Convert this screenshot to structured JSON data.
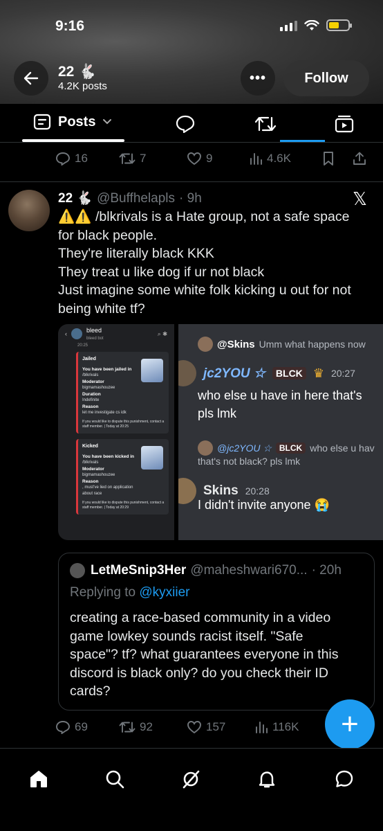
{
  "status_bar": {
    "time": "9:16"
  },
  "header": {
    "name": "22 🐇",
    "post_count": "4.2K posts",
    "more_label": "•••",
    "follow_label": "Follow"
  },
  "tabs": {
    "posts_label": "Posts"
  },
  "prev_actions": {
    "replies": "16",
    "reposts": "7",
    "likes": "9",
    "views": "4.6K"
  },
  "tweet": {
    "name": "22 🐇",
    "handle": "@Buffhelapls",
    "time": "· 9h",
    "lines": [
      "⚠️⚠️ /blkrivals is a Hate group, not a safe space",
      "for black people.",
      "They're literally black KKK",
      "They treat u like dog if ur not black",
      "Just imagine some white folk kicking u out for not",
      "being white tf?"
    ]
  },
  "media_left": {
    "bot_name": "bleed",
    "bot_sub": "bleed bot",
    "time": "20:25",
    "jailed": {
      "title": "Jailed",
      "l1": "You have been jailed in",
      "l2": "/blkrivals",
      "mod_label": "Moderator",
      "mod": "bigmamashouzee",
      "dur_label": "Duration",
      "dur": "Indefinite",
      "reason_label": "Reason",
      "reason": "let me investigate cs idk",
      "footer": "If you would like to dispute this punishment, contact a staff member. | Today at 20:25"
    },
    "kicked": {
      "title": "Kicked",
      "l1": "You have been kicked in",
      "l2": "/blkrivals",
      "mod_label": "Moderator",
      "mod": "bigmamashouzee",
      "reason_label": "Reason",
      "reason": ", must've lied on application about race",
      "footer": "If you would like to dispute this punishment, contact a staff member. | Today at 20:29"
    }
  },
  "media_right": {
    "reply1_user": "@Skins",
    "reply1_text": "Umm what happens now",
    "msg1_user": "jc2YOU ☆",
    "msg1_badge": "BLCK",
    "msg1_time": "20:27",
    "msg1_line1": "who else u have in here that's",
    "msg1_line2": "pls lmk",
    "reply2_user": "@jc2YOU ☆",
    "reply2_badge": "BLCK",
    "reply2_text": "who else u hav",
    "reply2_line2": "that's not black? pls lmk",
    "msg2_user": "Skins",
    "msg2_time": "20:28",
    "msg2_text": "I didn't invite anyone 😭"
  },
  "quote": {
    "name": "LetMeSnip3Her",
    "handle": "@maheshwari670...",
    "time": "· 20h",
    "replying_prefix": "Replying to",
    "replying_to": "@kyxiier",
    "lines": [
      "creating a race-based community in a video",
      "game lowkey sounds racist itself. \"Safe",
      "space\"? tf? what  guarantees everyone in this",
      "discord is black only? do you check their ID",
      "cards?"
    ]
  },
  "tweet_actions": {
    "replies": "69",
    "reposts": "92",
    "likes": "157",
    "views": "116K"
  },
  "fab_label": "+",
  "colors": {
    "accent": "#1d9bf0",
    "background": "#000000",
    "muted": "#71767b"
  }
}
